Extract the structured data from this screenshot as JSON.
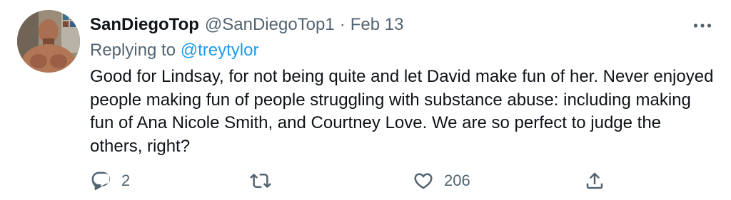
{
  "tweet": {
    "display_name": "SanDiegoTop",
    "handle": "@SanDiegoTop1",
    "separator": "·",
    "date": "Feb 13",
    "replying_prefix": "Replying to",
    "replying_to": "@treytylor",
    "text": "Good for Lindsay, for not being quite and let David make fun of her. Never enjoyed people making fun of people struggling with substance abuse: including making fun of Ana Nicole Smith, and Courtney Love. We are so perfect to judge the others, right?",
    "counts": {
      "replies": "2",
      "retweets": "",
      "likes": "206"
    },
    "icons": {
      "more": "more-horizontal-icon",
      "reply": "reply-icon",
      "retweet": "retweet-icon",
      "like": "heart-icon",
      "share": "share-icon"
    },
    "colors": {
      "text": "#0f1419",
      "secondary": "#536471",
      "link": "#1d9bf0"
    }
  }
}
